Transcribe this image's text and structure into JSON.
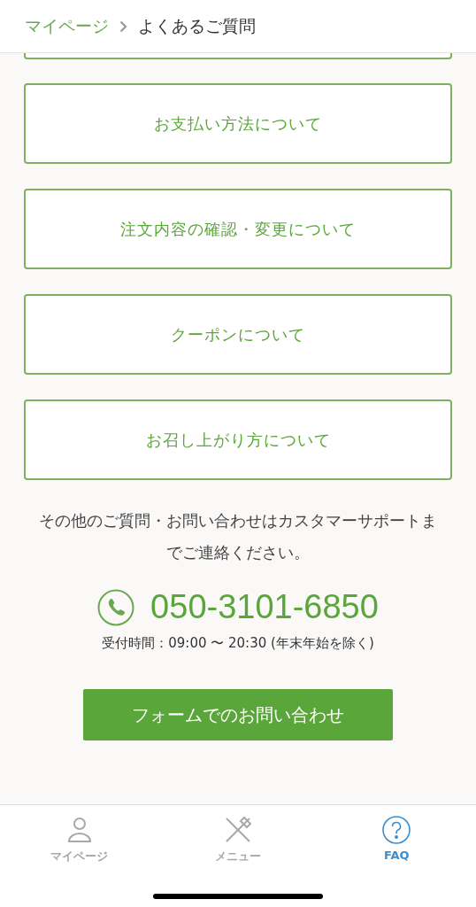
{
  "breadcrumb": [
    {
      "label": "マイページ",
      "link": true
    },
    {
      "label": "よくあるご質問",
      "link": false
    }
  ],
  "faq_items": [
    {
      "label": "お支払い方法について"
    },
    {
      "label": "注文内容の確認・変更について"
    },
    {
      "label": "クーポンについて"
    },
    {
      "label": "お召し上がり方について"
    }
  ],
  "support": {
    "message": "その他のご質問・お問い合わせはカスタマーサポートまでご連絡ください。",
    "phone": "050-3101-6850",
    "hours": "受付時間：09:00 〜 20:30 (年末年始を除く)",
    "form_button": "フォームでのお問い合わせ"
  },
  "tab_bar": [
    {
      "label": "マイページ",
      "kind": "person",
      "selected": false
    },
    {
      "label": "メニュー",
      "kind": "cutlery",
      "selected": false
    },
    {
      "label": "FAQ",
      "kind": "question",
      "selected": true
    }
  ]
}
